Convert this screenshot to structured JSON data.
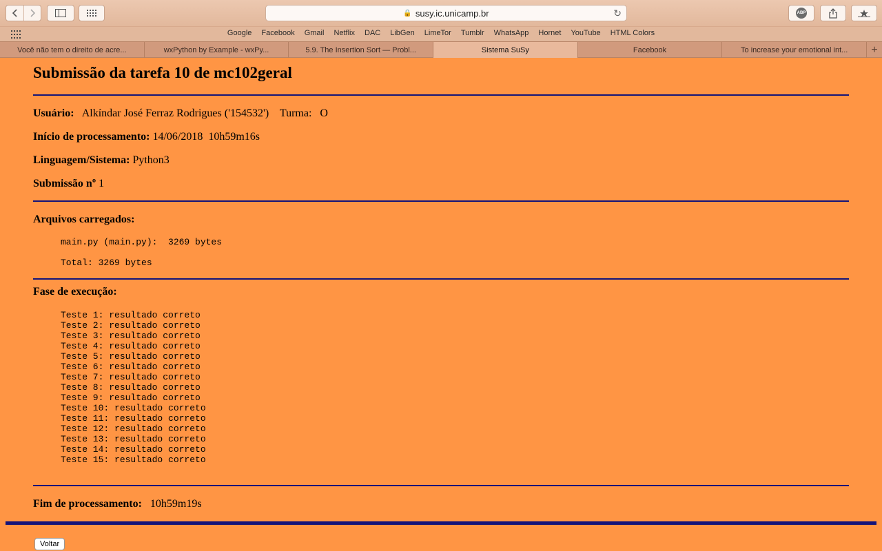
{
  "browser": {
    "url": "susy.ic.unicamp.br",
    "abp_label": "ABP",
    "favorites": [
      "Google",
      "Facebook",
      "Gmail",
      "Netflix",
      "DAC",
      "LibGen",
      "LimeTor",
      "Tumblr",
      "WhatsApp",
      "Hornet",
      "YouTube",
      "HTML Colors"
    ],
    "tabs": [
      {
        "title": "Você não tem o direito de acre...",
        "active": false
      },
      {
        "title": "wxPython by Example - wxPy...",
        "active": false
      },
      {
        "title": "5.9. The Insertion Sort — Probl...",
        "active": false
      },
      {
        "title": "Sistema SuSy",
        "active": true
      },
      {
        "title": "Facebook",
        "active": false
      },
      {
        "title": "To increase your emotional int...",
        "active": false
      }
    ]
  },
  "page": {
    "title": "Submissão da tarefa 10 de mc102geral",
    "usuario_label": "Usuário:",
    "usuario_value": "Alkíndar José Ferraz Rodrigues ('154532')",
    "turma_label": "Turma:",
    "turma_value": "O",
    "inicio_label": "Início de processamento:",
    "inicio_value": "14/06/2018  10h59m16s",
    "linguagem_label": "Linguagem/Sistema:",
    "linguagem_value": "Python3",
    "submissao_label": "Submissão nº",
    "submissao_value": "1",
    "arquivos_label": "Arquivos carregados:",
    "arquivo_line": "main.py (main.py):  3269 bytes",
    "total_line": "Total: 3269 bytes",
    "fase_label": "Fase de execução:",
    "tests": [
      "Teste 1: resultado correto",
      "Teste 2: resultado correto",
      "Teste 3: resultado correto",
      "Teste 4: resultado correto",
      "Teste 5: resultado correto",
      "Teste 6: resultado correto",
      "Teste 7: resultado correto",
      "Teste 8: resultado correto",
      "Teste 9: resultado correto",
      "Teste 10: resultado correto",
      "Teste 11: resultado correto",
      "Teste 12: resultado correto",
      "Teste 13: resultado correto",
      "Teste 14: resultado correto",
      "Teste 15: resultado correto"
    ],
    "fim_label": "Fim de processamento:",
    "fim_value": "10h59m19s",
    "voltar_label": "Voltar"
  },
  "colors": {
    "page_background": "#ff9544",
    "rule_color": "#13137a"
  }
}
